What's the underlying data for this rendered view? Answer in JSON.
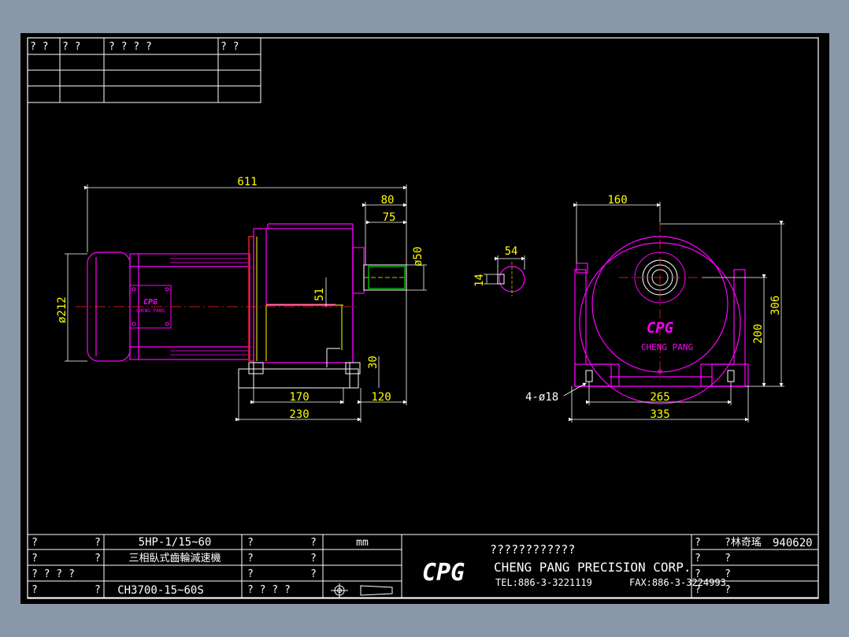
{
  "header_table": {
    "row1": [
      "?  ?",
      "?  ?",
      "?   ?   ?   ?",
      "?  ?"
    ]
  },
  "views": {
    "side": {
      "dims": {
        "overall_length": "611",
        "shaft_80": "80",
        "shaft_75": "75",
        "shaft_dia": "ø50",
        "motor_dia": "ø212",
        "center_51": "51",
        "foot_30": "30",
        "base_170": "170",
        "base_120": "120",
        "base_230": "230"
      },
      "nameplate": {
        "logo": "CPG",
        "text": "CHENG PANG"
      }
    },
    "key": {
      "dims": {
        "key_54": "54",
        "key_14": "14"
      }
    },
    "front": {
      "dims": {
        "width_160": "160",
        "height_306": "306",
        "height_200": "200",
        "holes": "4-ø18",
        "base_265": "265",
        "base_335": "335"
      },
      "logo": "CPG",
      "brand": "CHENG PANG"
    }
  },
  "title_block": {
    "left": {
      "r1": [
        "?",
        "?"
      ],
      "r2": [
        "?",
        "?"
      ],
      "r3": [
        "?  ?  ?  ?",
        ""
      ],
      "r4": [
        "?",
        "?"
      ]
    },
    "spec": {
      "power": "5HP-1/15~60",
      "name": "三相臥式齒輪減速機",
      "model": "CH3700-15~60S"
    },
    "mid": {
      "r1": [
        "?",
        "?"
      ],
      "r2": [
        "?",
        "?"
      ],
      "r3": [
        "?",
        "?"
      ],
      "r4": "?  ?  ?  ?"
    },
    "unit": "mm",
    "company": {
      "logo": "CPG",
      "chinese": "????????????",
      "english": "CHENG PANG PRECISION CORP.",
      "tel": "TEL:886-3-3221119",
      "fax": "FAX:886-3-3224993"
    },
    "right": {
      "r1a": "?",
      "r1b": "?林奇瑤",
      "r1c": "940620",
      "r2": [
        "?",
        "?"
      ],
      "r3": [
        "?",
        "?"
      ],
      "r4": [
        "?",
        "?"
      ]
    }
  },
  "colors": {
    "background": "#8a97a8",
    "sheet": "#000000",
    "line": "#ffffff",
    "magenta": "#ff00ff",
    "yellow": "#ffff00",
    "green": "#00ff00",
    "red": "#ff2020"
  }
}
